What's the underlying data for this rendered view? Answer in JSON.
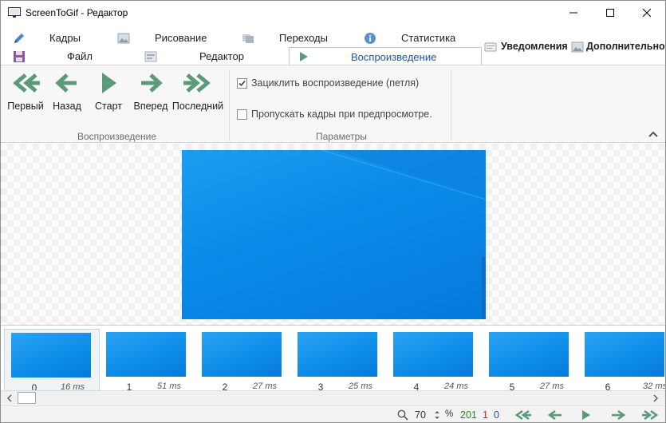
{
  "window": {
    "title": "ScreenToGif - Редактор"
  },
  "tabs": {
    "row1": [
      {
        "label": "Кадры",
        "icon": "pencil-icon"
      },
      {
        "label": "Рисование",
        "icon": "image-icon"
      },
      {
        "label": "Переходы",
        "icon": "transition-icon"
      },
      {
        "label": "Статистика",
        "icon": "info-icon"
      }
    ],
    "row2": [
      {
        "label": "Файл",
        "icon": "save-icon"
      },
      {
        "label": "Редактор",
        "icon": "editor-icon"
      },
      {
        "label": "Воспроизведение",
        "icon": "play-icon"
      }
    ],
    "notifications": "Уведомления",
    "extras": "Дополнительно"
  },
  "ribbon": {
    "playback_buttons": [
      {
        "label": "Первый",
        "icon": "first-frame-icon"
      },
      {
        "label": "Назад",
        "icon": "previous-frame-icon"
      },
      {
        "label": "Старт",
        "icon": "play-icon"
      },
      {
        "label": "Вперед",
        "icon": "next-frame-icon"
      },
      {
        "label": "Последний",
        "icon": "last-frame-icon"
      }
    ],
    "playback_group": "Воспроизведение",
    "params_group": "Параметры",
    "loop_label": "Зациклить воспроизведение (петля)",
    "loop_checked": true,
    "skip_label": "Пропускать кадры при предпросмотре.",
    "skip_checked": false
  },
  "frames": [
    {
      "index": "0",
      "ms": "16 ms"
    },
    {
      "index": "1",
      "ms": "51 ms"
    },
    {
      "index": "2",
      "ms": "27 ms"
    },
    {
      "index": "3",
      "ms": "25 ms"
    },
    {
      "index": "4",
      "ms": "24 ms"
    },
    {
      "index": "5",
      "ms": "27 ms"
    },
    {
      "index": "6",
      "ms": "32 ms"
    }
  ],
  "status": {
    "zoom": "70",
    "zoom_unit": "%",
    "frame_count": "201",
    "selected_count": "1",
    "selected_index": "0"
  },
  "colors": {
    "accent": "#1a56b0",
    "arrow_green": "#5b9b78",
    "count_green": "#1e8a1e",
    "count_red": "#c81e1e",
    "count_blue": "#1a56b0"
  }
}
